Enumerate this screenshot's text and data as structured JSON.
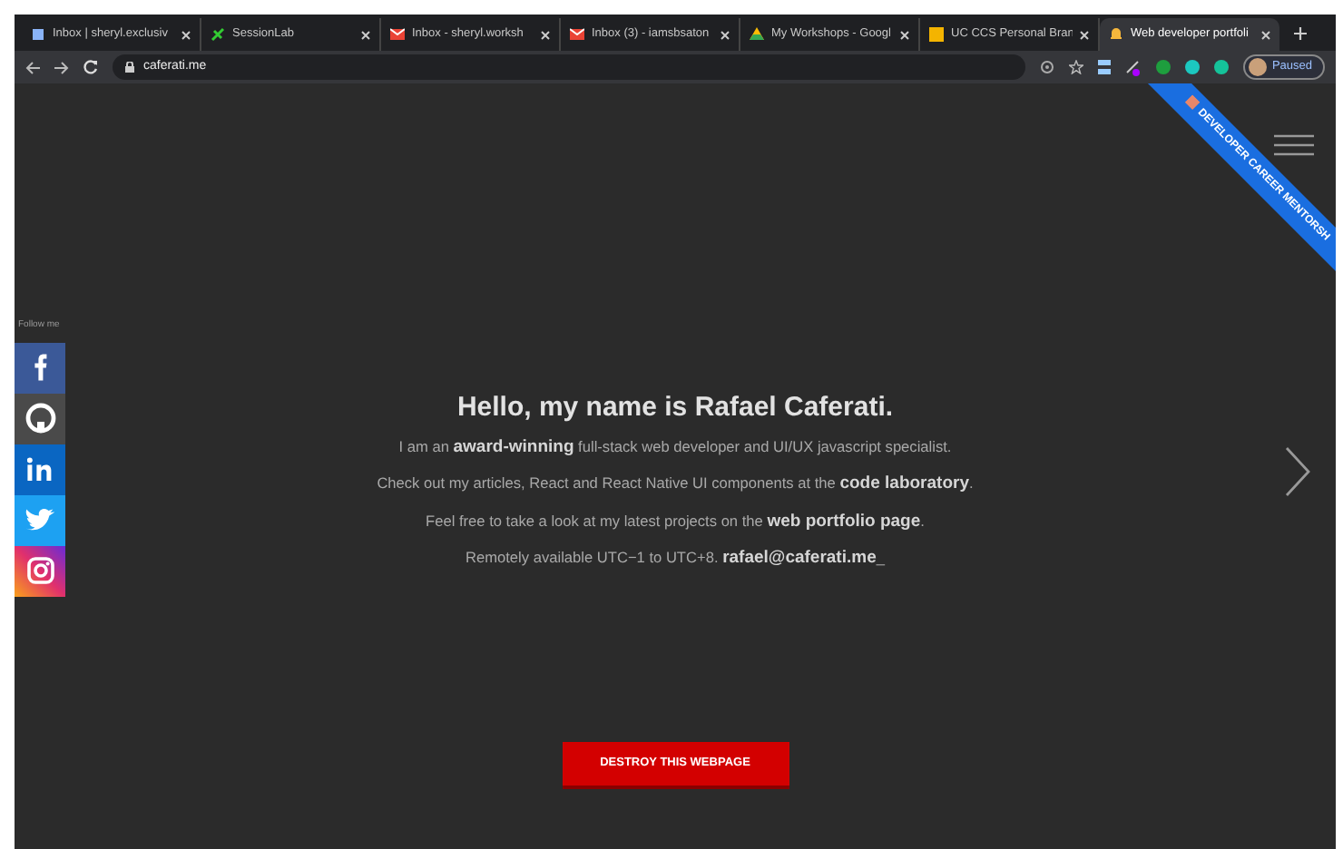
{
  "tabs": [
    {
      "title": "Inbox | sheryl.exclusiv",
      "selected": false
    },
    {
      "title": "SessionLab",
      "selected": false
    },
    {
      "title": "Inbox - sheryl.worksh",
      "selected": false
    },
    {
      "title": "Inbox (3) - iamsbsaton",
      "selected": false
    },
    {
      "title": "My Workshops - Googl",
      "selected": false
    },
    {
      "title": "UC CCS Personal Bran",
      "selected": false
    },
    {
      "title": "Web developer portfoli",
      "selected": true
    }
  ],
  "address_bar": {
    "url": "caferati.me"
  },
  "profile": {
    "label": "Paused"
  },
  "ribbon": {
    "label": "DEVELOPER CAREER MENTORSH"
  },
  "social": {
    "label": "Follow me",
    "items": [
      {
        "kind": "facebook",
        "color": "#3b5998"
      },
      {
        "kind": "github",
        "color": "#4a4a4a"
      },
      {
        "kind": "linkedin",
        "color": "#0a66c2"
      },
      {
        "kind": "twitter",
        "color": "#1da1f2"
      },
      {
        "kind": "instagram",
        "color": "#c13584"
      }
    ]
  },
  "hero": {
    "heading": "Hello, my name is Rafael Caferati.",
    "lines": [
      "I am an **award-winning** full-stack web developer and UI/UX javascript specialist.",
      "Check out my articles, React and React Native UI components at the **code laboratory**.",
      "Feel free to take a look at my latest projects on the **web portfolio page**.",
      "Remotely available UTC−1 to UTC+8. **rafael@caferati.me**_"
    ]
  },
  "action_button": {
    "label": "DESTROY THIS WEBPAGE"
  }
}
